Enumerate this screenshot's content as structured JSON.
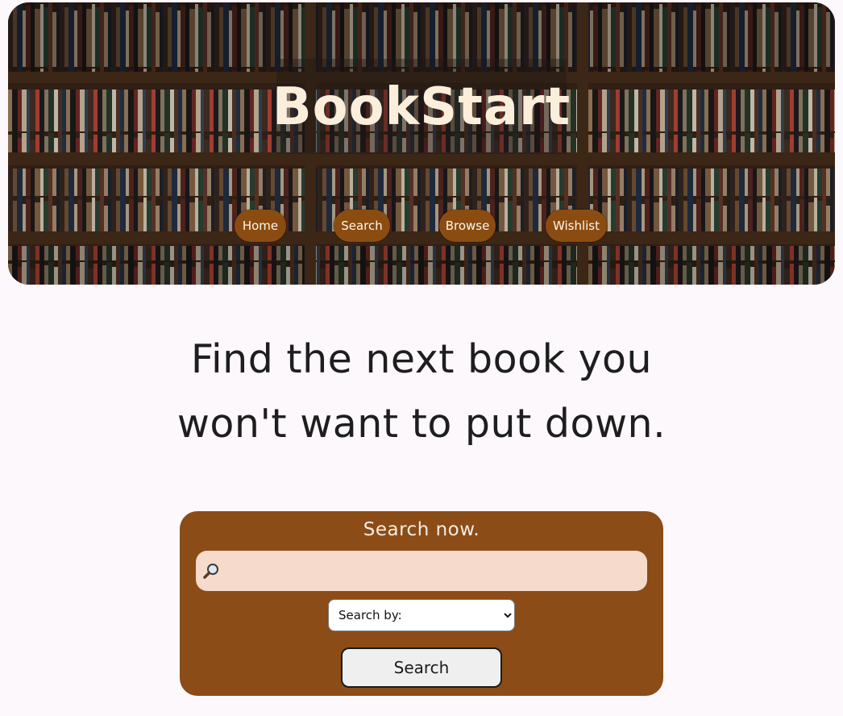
{
  "header": {
    "title": "BookStart",
    "nav": [
      {
        "label": "Home"
      },
      {
        "label": "Search"
      },
      {
        "label": "Browse"
      },
      {
        "label": "Wishlist"
      }
    ]
  },
  "main": {
    "headline_line1": "Find the next book you",
    "headline_line2": "won't want to put down."
  },
  "search": {
    "heading": "Search now.",
    "input_value": "",
    "input_placeholder": "",
    "select_value": "Search by:",
    "button_label": "Search",
    "icon": "magnifier-icon"
  },
  "colors": {
    "page_bg": "#fcf8fc",
    "nav_button": "#8b4c12",
    "search_card": "#8b4c18",
    "search_input_bg": "#f6dacb",
    "title_text": "#fbeedb"
  }
}
